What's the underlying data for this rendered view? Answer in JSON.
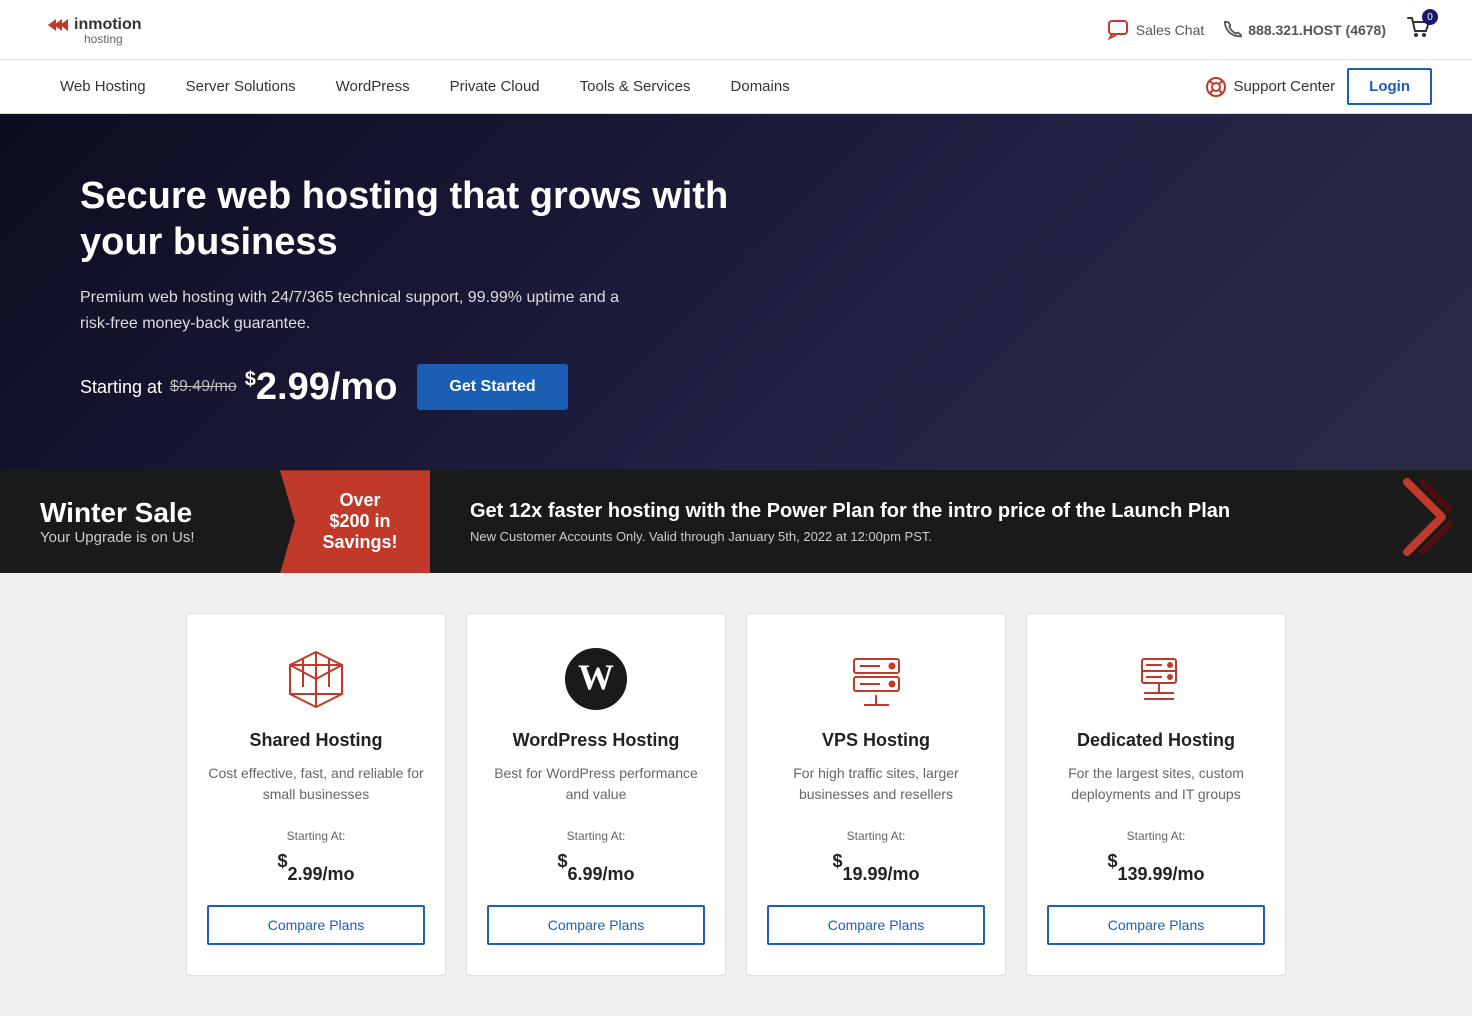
{
  "header": {
    "logo_line1": "inmotion",
    "logo_line2": "hosting",
    "sales_chat": "Sales Chat",
    "phone": "888.321.HOST (4678)",
    "cart_count": "0"
  },
  "nav": {
    "items": [
      {
        "label": "Web Hosting",
        "id": "web-hosting"
      },
      {
        "label": "Server Solutions",
        "id": "server-solutions"
      },
      {
        "label": "WordPress",
        "id": "wordpress"
      },
      {
        "label": "Private Cloud",
        "id": "private-cloud"
      },
      {
        "label": "Tools & Services",
        "id": "tools-services"
      },
      {
        "label": "Domains",
        "id": "domains"
      }
    ],
    "support_center": "Support Center",
    "login": "Login"
  },
  "hero": {
    "headline": "Secure web hosting that grows with your business",
    "subtext": "Premium web hosting with 24/7/365 technical support, 99.99% uptime and a risk-free money-back guarantee.",
    "starting_at": "Starting at",
    "old_price": "$9.49/mo",
    "new_price_dollar": "$",
    "new_price": "2.99/mo",
    "cta": "Get Started"
  },
  "winter_sale": {
    "title": "Winter Sale",
    "subtitle": "Your Upgrade is on Us!",
    "savings_line1": "Over",
    "savings_line2": "$200 in",
    "savings_line3": "Savings!",
    "promo_headline": "Get 12x faster hosting with the Power Plan for the intro price of the Launch Plan",
    "promo_note": "New Customer Accounts Only. Valid through January 5th, 2022 at 12:00pm PST."
  },
  "hosting_cards": [
    {
      "id": "shared",
      "title": "Shared Hosting",
      "description": "Cost effective, fast, and reliable for small businesses",
      "starting_at": "Starting At:",
      "price_dollar": "$",
      "price": "2.99",
      "price_period": "/mo",
      "cta": "Compare Plans",
      "icon_type": "cube-outline"
    },
    {
      "id": "wordpress",
      "title": "WordPress Hosting",
      "description": "Best for WordPress performance and value",
      "starting_at": "Starting At:",
      "price_dollar": "$",
      "price": "6.99",
      "price_period": "/mo",
      "cta": "Compare Plans",
      "icon_type": "wordpress"
    },
    {
      "id": "vps",
      "title": "VPS Hosting",
      "description": "For high traffic sites, larger businesses and resellers",
      "starting_at": "Starting At:",
      "price_dollar": "$",
      "price": "19.99",
      "price_period": "/mo",
      "cta": "Compare Plans",
      "icon_type": "server-outline"
    },
    {
      "id": "dedicated",
      "title": "Dedicated Hosting",
      "description": "For the largest sites, custom deployments and IT groups",
      "starting_at": "Starting At:",
      "price_dollar": "$",
      "price": "139.99",
      "price_period": "/mo",
      "cta": "Compare Plans",
      "icon_type": "server-small"
    }
  ],
  "colors": {
    "brand_red": "#c0392b",
    "brand_blue": "#1a5fb4",
    "dark_navy": "#1a1a3e"
  }
}
